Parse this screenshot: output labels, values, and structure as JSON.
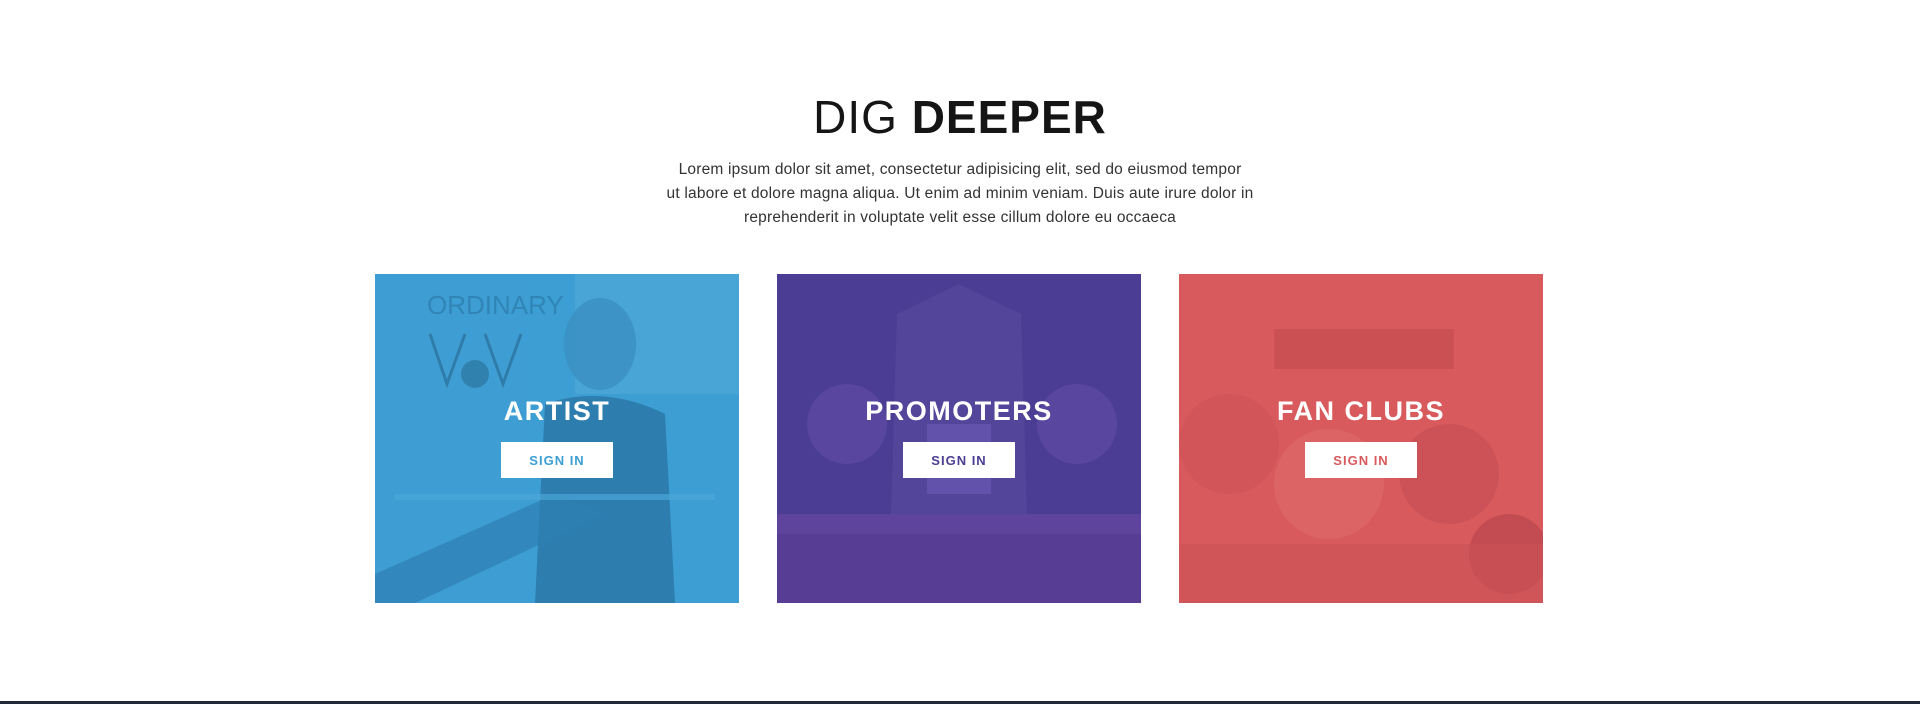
{
  "section": {
    "title_light": "DIG",
    "title_bold": "DEEPER",
    "description_lines": [
      "Lorem ipsum dolor sit amet, consectetur adipisicing elit, sed do eiusmod tempor",
      "ut labore et dolore magna aliqua. Ut enim ad minim veniam. Duis aute irure dolor in",
      "reprehenderit in voluptate velit esse cillum dolore eu occaeca"
    ]
  },
  "cards": [
    {
      "title": "ARTIST",
      "button_label": "SIGN IN",
      "overlay_color": "#3c9ed3"
    },
    {
      "title": "PROMOTERS",
      "button_label": "SIGN IN",
      "overlay_color": "#4b3d93"
    },
    {
      "title": "FAN CLUBS",
      "button_label": "SIGN IN",
      "overlay_color": "#d85a5c"
    }
  ],
  "colors": {
    "footer_line": "#23273a",
    "heading_text": "#151515",
    "body_text": "#333333"
  }
}
